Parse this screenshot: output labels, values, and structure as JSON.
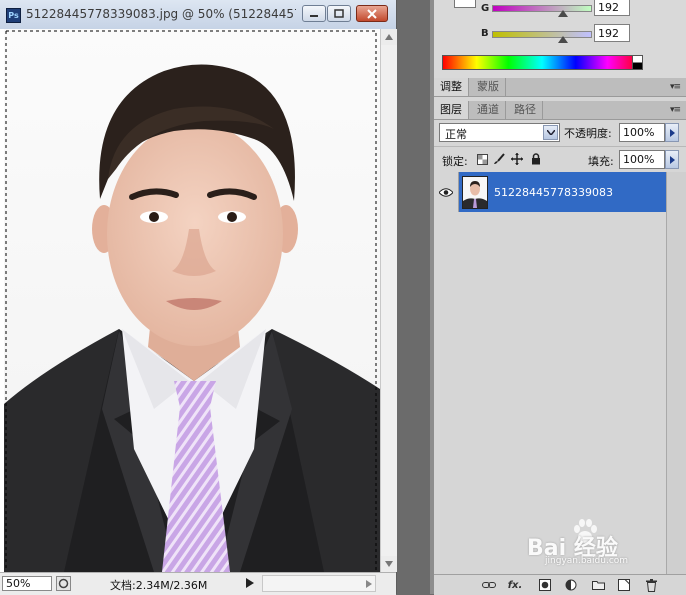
{
  "window": {
    "title": "51228445778339083.jpg @ 50% (512284457...",
    "app_icon": "Ps"
  },
  "status": {
    "zoom": "50%",
    "doc_size": "文档:2.34M/2.36M"
  },
  "color_panel": {
    "g_label": "G",
    "g_value": "192",
    "b_label": "B",
    "b_value": "192"
  },
  "adjust_tabs": [
    "调整",
    "蒙版"
  ],
  "layer_tabs": [
    "图层",
    "通道",
    "路径"
  ],
  "layers_panel": {
    "blend_mode": "正常",
    "opacity_label": "不透明度:",
    "opacity_value": "100%",
    "lock_label": "锁定:",
    "fill_label": "填充:",
    "fill_value": "100%",
    "layers": [
      {
        "name": "51228445778339083"
      }
    ],
    "footer_icons": [
      "link-icon",
      "fx-icon",
      "mask-icon",
      "adjustment-icon",
      "group-folder-icon",
      "new-layer-icon",
      "trash-icon"
    ],
    "footer_fx": "fx."
  },
  "watermark": {
    "text": "Bai 经验",
    "url": "jingyan.baidu.com"
  }
}
